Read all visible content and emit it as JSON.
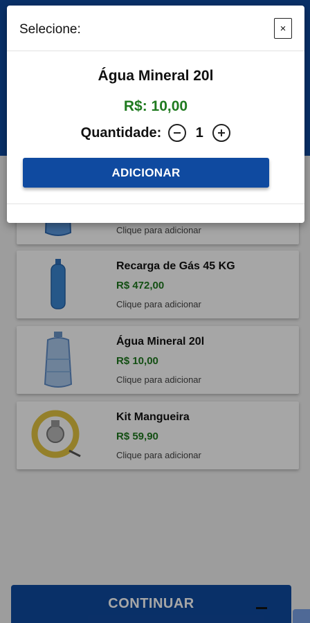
{
  "products": [
    {
      "name": "",
      "price": "",
      "hint": "Clique para adicionar",
      "icon": "water-jug-icon"
    },
    {
      "name": "Recarga de Gás 45 KG",
      "price": "R$ 472,00",
      "hint": "Clique para adicionar",
      "icon": "gas-cylinder-icon"
    },
    {
      "name": "Água Mineral 20l",
      "price": "R$ 10,00",
      "hint": "Clique para adicionar",
      "icon": "water-jug-icon"
    },
    {
      "name": "Kit Mangueira",
      "price": "R$ 59,90",
      "hint": "Clique para adicionar",
      "icon": "hose-kit-icon"
    }
  ],
  "footer": {
    "continue_label": "CONTINUAR"
  },
  "modal": {
    "title": "Selecione:",
    "close_label": "×",
    "product_name": "Água Mineral 20l",
    "price": "R$: 10,00",
    "quantity_label": "Quantidade:",
    "quantity": "1",
    "add_label": "ADICIONAR"
  },
  "colors": {
    "brand_blue": "#0f4aa0",
    "price_green": "#1f7a1f"
  }
}
